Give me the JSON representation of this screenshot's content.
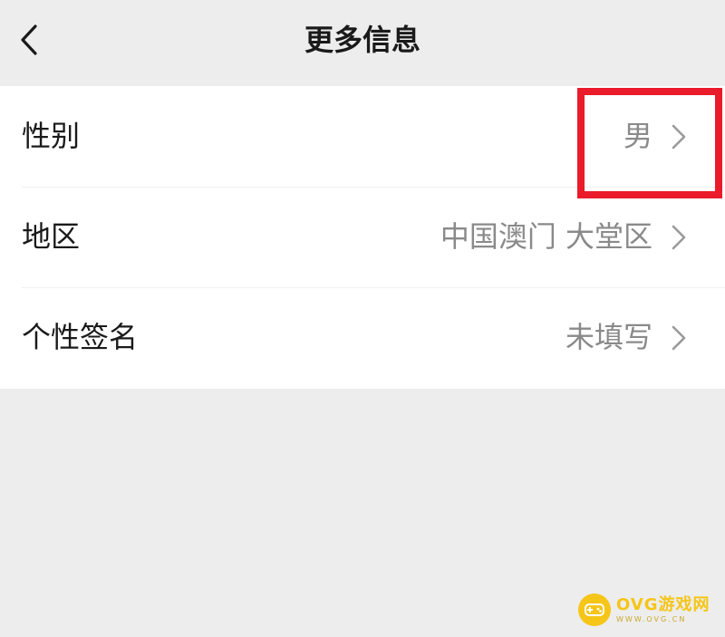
{
  "header": {
    "title": "更多信息",
    "back_icon": "chevron-left-icon"
  },
  "rows": [
    {
      "label": "性别",
      "value": "男",
      "highlighted": true
    },
    {
      "label": "地区",
      "value": "中国澳门 大堂区",
      "highlighted": false
    },
    {
      "label": "个性签名",
      "value": "未填写",
      "highlighted": false
    }
  ],
  "colors": {
    "background": "#ededed",
    "card": "#ffffff",
    "label_text": "#1a1a1a",
    "value_text": "#8a8a8a",
    "highlight": "#ea1b2b",
    "watermark": "#f5c518"
  },
  "watermark": {
    "title": "OVG游戏网",
    "url": "WWW.OVG.CN"
  }
}
